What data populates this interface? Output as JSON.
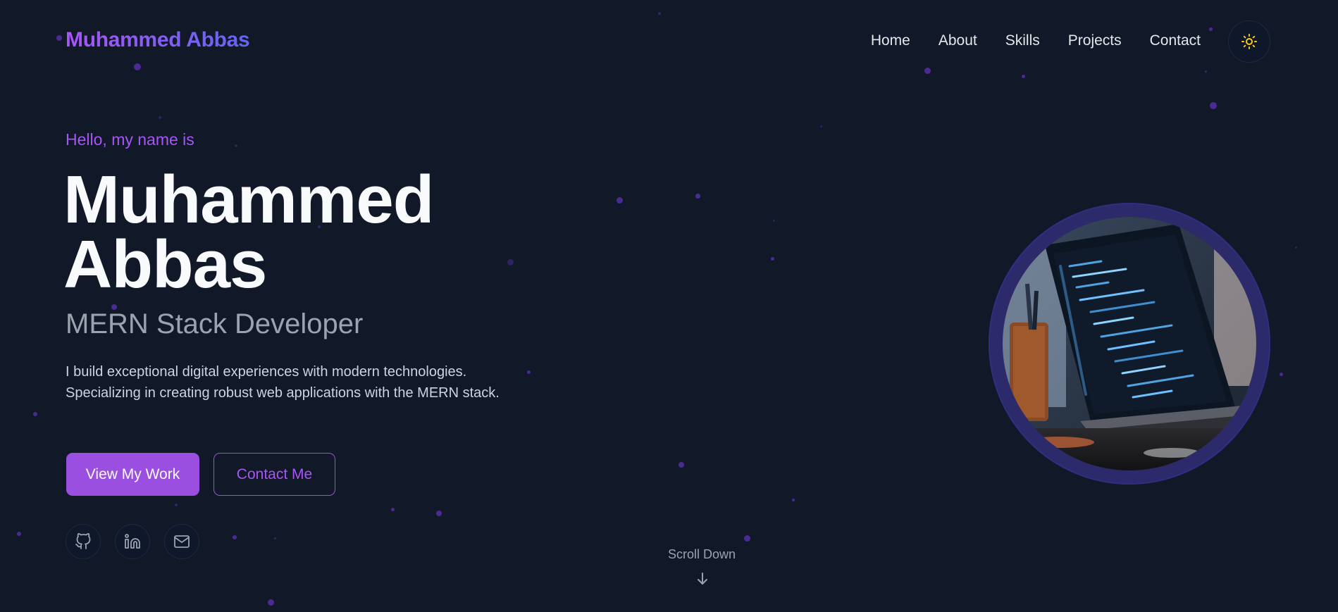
{
  "header": {
    "logo": "Muhammed Abbas",
    "nav": [
      "Home",
      "About",
      "Skills",
      "Projects",
      "Contact"
    ],
    "theme_icon": "sun-icon"
  },
  "hero": {
    "greeting": "Hello, my name is",
    "name_line1": "Muhammed",
    "name_line2": "Abbas",
    "role": "MERN Stack Developer",
    "description": "I build exceptional digital experiences with modern technologies. Specializing in creating robust web applications with the MERN stack.",
    "primary_button": "View My Work",
    "secondary_button": "Contact Me",
    "socials": [
      "github-icon",
      "linkedin-icon",
      "mail-icon"
    ]
  },
  "scroll": {
    "label": "Scroll Down",
    "icon": "arrow-down-icon"
  },
  "image": {
    "subject": "laptop-code-photo"
  },
  "colors": {
    "background": "#111827",
    "accent": "#9b4fe0",
    "accent_light": "#a855f7",
    "indigo": "#6366f1",
    "ring": "#2c2a6a",
    "sun": "#facc15"
  }
}
